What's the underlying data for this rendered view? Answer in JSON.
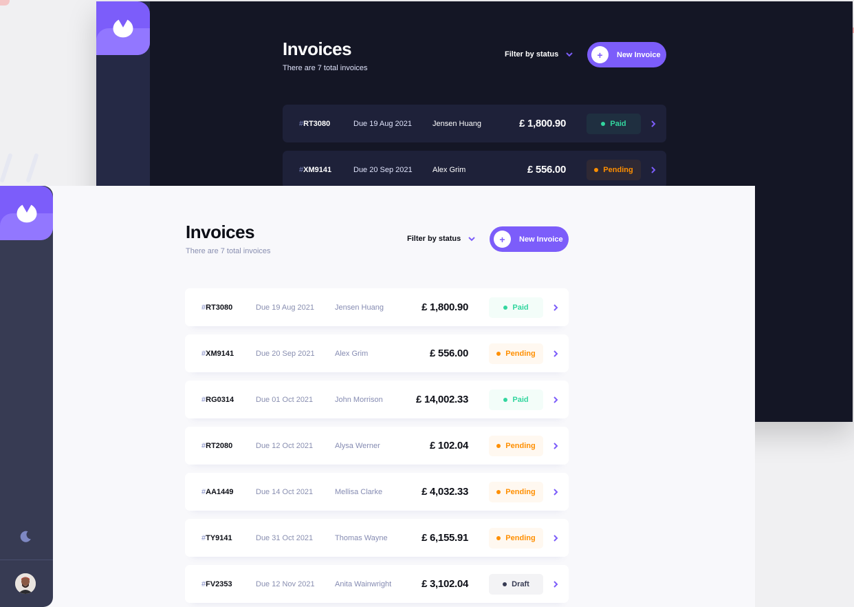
{
  "app": {
    "title": "Invoices",
    "subtitle": "There are 7 total invoices",
    "filter_label": "Filter by status",
    "new_invoice_label": "New Invoice",
    "plus_symbol": "+",
    "currency_symbol": "£",
    "due_prefix": "Due"
  },
  "colors": {
    "accent": "#7c5dfa",
    "accent_light": "#9277ff",
    "paid": "#33d69f",
    "pending": "#ff8f00",
    "draft": "#373b53",
    "dark_bg": "#141625",
    "dark_card": "#1e2139",
    "light_bg": "#f8f8fb"
  },
  "icons": {
    "logo": "logo-icon",
    "filter_chevron": "chevron-down-icon",
    "plus": "plus-icon",
    "row_arrow": "chevron-right-icon",
    "theme_toggle": "moon-icon",
    "avatar": "avatar"
  },
  "dark_invoices": [
    {
      "hash": "#",
      "id": "RT3080",
      "due": "Due 19 Aug 2021",
      "name": "Jensen Huang",
      "amount": "£ 1,800.90",
      "status": "Paid"
    },
    {
      "hash": "#",
      "id": "XM9141",
      "due": "Due 20 Sep 2021",
      "name": "Alex Grim",
      "amount": "£ 556.00",
      "status": "Pending"
    }
  ],
  "invoices": [
    {
      "hash": "#",
      "id": "RT3080",
      "due": "Due 19 Aug 2021",
      "name": "Jensen Huang",
      "amount": "£ 1,800.90",
      "status": "Paid"
    },
    {
      "hash": "#",
      "id": "XM9141",
      "due": "Due 20 Sep 2021",
      "name": "Alex Grim",
      "amount": "£ 556.00",
      "status": "Pending"
    },
    {
      "hash": "#",
      "id": "RG0314",
      "due": "Due 01 Oct 2021",
      "name": "John Morrison",
      "amount": "£ 14,002.33",
      "status": "Paid"
    },
    {
      "hash": "#",
      "id": "RT2080",
      "due": "Due 12 Oct 2021",
      "name": "Alysa Werner",
      "amount": "£ 102.04",
      "status": "Pending"
    },
    {
      "hash": "#",
      "id": "AA1449",
      "due": "Due 14 Oct 2021",
      "name": "Mellisa Clarke",
      "amount": "£ 4,032.33",
      "status": "Pending"
    },
    {
      "hash": "#",
      "id": "TY9141",
      "due": "Due 31 Oct 2021",
      "name": "Thomas Wayne",
      "amount": "£ 6,155.91",
      "status": "Pending"
    },
    {
      "hash": "#",
      "id": "FV2353",
      "due": "Due 12 Nov 2021",
      "name": "Anita Wainwright",
      "amount": "£ 3,102.04",
      "status": "Draft"
    }
  ]
}
